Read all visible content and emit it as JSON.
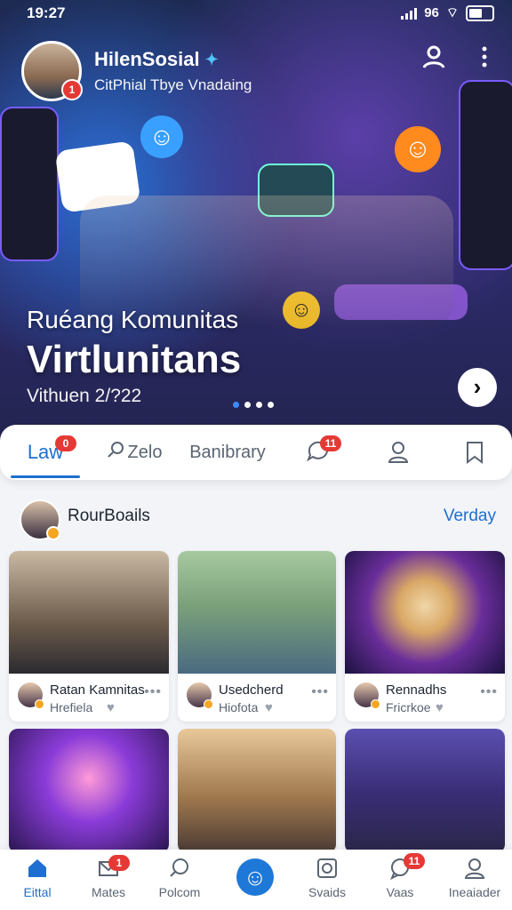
{
  "status": {
    "time": "19:27",
    "network": "96"
  },
  "profile": {
    "name": "HilenSosial",
    "subtitle": "CitPhial Tbye Vnadaing",
    "notification_count": "1"
  },
  "hero": {
    "title_small": "Ruéang Komunitas",
    "title_large": "Virtlunitans",
    "date": "Vithuen 2/?22"
  },
  "tabs": [
    {
      "label": "Law",
      "badge": "0"
    },
    {
      "label": "Zelo"
    },
    {
      "label": "Banibrary"
    },
    {
      "label": "",
      "badge": "11"
    },
    {
      "label": ""
    },
    {
      "label": ""
    }
  ],
  "section": {
    "title": "RourBoails",
    "link": "Verday"
  },
  "cards": [
    {
      "title": "Ratan Kamnitas",
      "sub": "Hrefiela"
    },
    {
      "title": "Usedcherd",
      "sub": "Hiofota"
    },
    {
      "title": "Rennadhs",
      "sub": "Fricrkoe"
    }
  ],
  "bottom_nav": [
    {
      "label": "Eittal",
      "icon": "home-icon"
    },
    {
      "label": "Mates",
      "icon": "mail-icon",
      "badge": "1"
    },
    {
      "label": "Polcom",
      "icon": "search-icon"
    },
    {
      "label": "",
      "icon": "smile-icon"
    },
    {
      "label": "Svaids",
      "icon": "square-icon"
    },
    {
      "label": "Vaas",
      "icon": "chat-icon",
      "badge": "11"
    },
    {
      "label": "Ineaiader",
      "icon": "user-icon"
    }
  ],
  "colors": {
    "accent": "#1e6fd0",
    "badge": "#e53935",
    "hero_bg": "#1d2a52"
  }
}
